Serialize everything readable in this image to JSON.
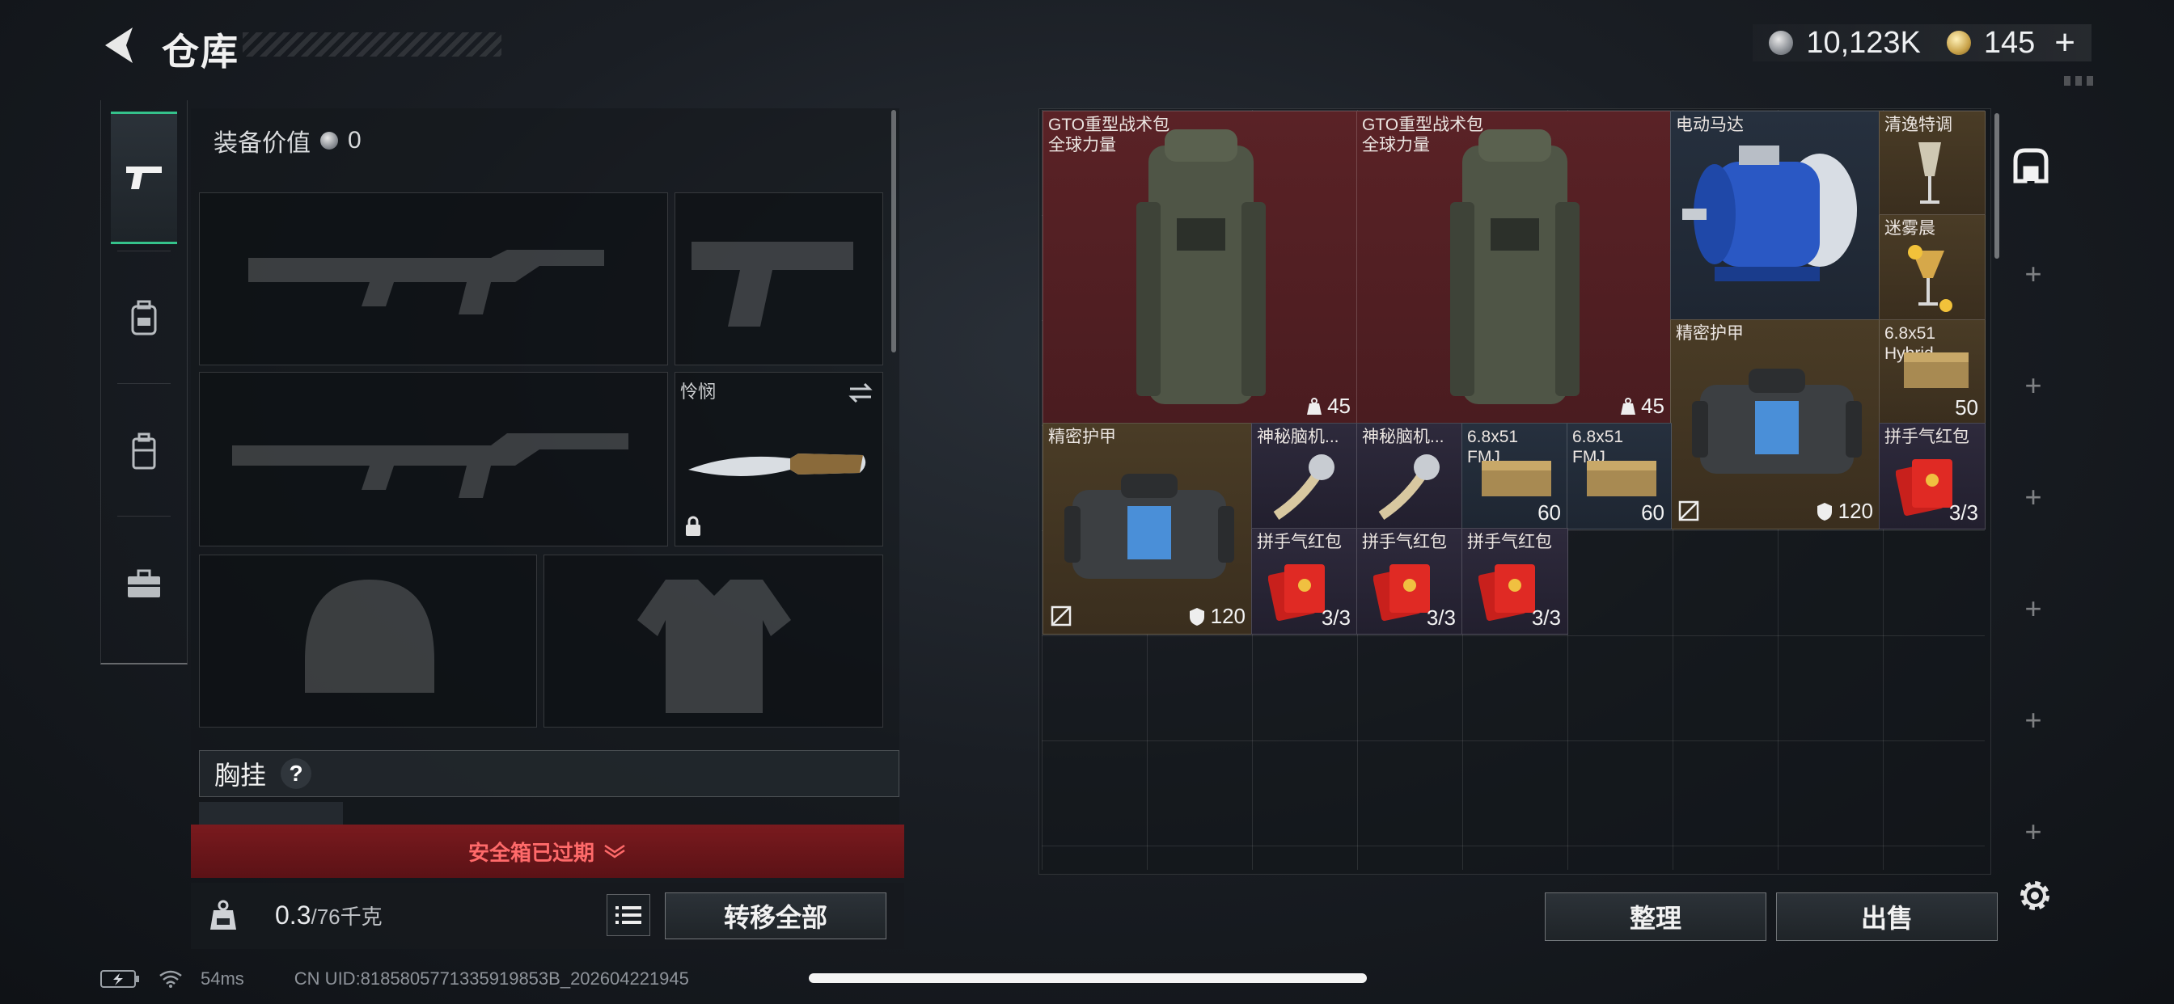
{
  "header": {
    "title": "仓库",
    "currency_silver": "10,123K",
    "currency_gold": "145",
    "plus": "+"
  },
  "rail_tabs": [
    {
      "name": "pistol-icon",
      "active": true
    },
    {
      "name": "backpack-icon",
      "active": false
    },
    {
      "name": "vest-icon",
      "active": false
    },
    {
      "name": "toolbox-icon",
      "active": false
    }
  ],
  "equipment": {
    "value_label": "装备价值",
    "value": "0",
    "melee_label": "怜悯",
    "chest_label": "胸挂",
    "help": "?",
    "safebox_expired": "安全箱已过期",
    "weight": "0.3",
    "weight_max": "/76千克",
    "transfer_all": "转移全部"
  },
  "stash": {
    "items": [
      {
        "name_line1": "GTO重型战术包",
        "name_line2": "全球力量",
        "count": "45"
      },
      {
        "name_line1": "GTO重型战术包",
        "name_line2": "全球力量",
        "count": "45"
      },
      {
        "name_line1": "电动马达"
      },
      {
        "name_line1": "清逸特调"
      },
      {
        "name_line1": "迷雾晨"
      },
      {
        "name_line1": "精密护甲",
        "durability": "120"
      },
      {
        "name_line1": "6.8x51",
        "name_line2": "Hybrid",
        "count": "50"
      },
      {
        "name_line1": "精密护甲",
        "durability": "120"
      },
      {
        "name_line1": "神秘脑机..."
      },
      {
        "name_line1": "神秘脑机..."
      },
      {
        "name_line1": "6.8x51",
        "name_line2": "FMJ",
        "count": "60"
      },
      {
        "name_line1": "6.8x51",
        "name_line2": "FMJ",
        "count": "60"
      },
      {
        "name_line1": "拼手气红包",
        "count": "3/3"
      },
      {
        "name_line1": "拼手气红包",
        "count": "3/3"
      },
      {
        "name_line1": "拼手气红包",
        "count": "3/3"
      },
      {
        "name_line1": "拼手气红包",
        "count": "3/3"
      }
    ],
    "sort_label": "整理",
    "sell_label": "出售"
  },
  "status": {
    "ping": "54ms",
    "uid": "CN UID:8185805771335919853B_202604221945"
  },
  "colors": {
    "accent_green": "#35c28b",
    "red_item": "#5a2226",
    "gold_item": "#4a3c26",
    "blue_item": "#26303e",
    "purple_item": "#2e2a3c",
    "expired_text": "#ff6a6a"
  }
}
